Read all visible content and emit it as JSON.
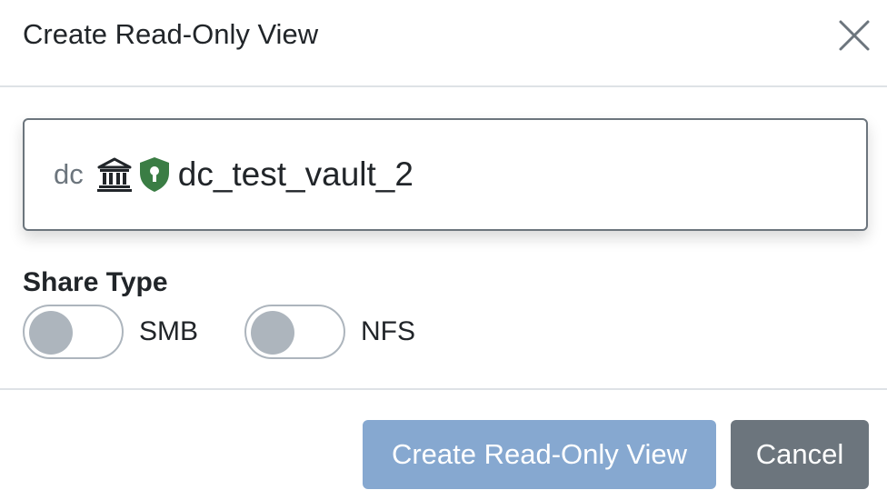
{
  "modal": {
    "title": "Create Read-Only View",
    "close_icon": "close-icon"
  },
  "source": {
    "cluster": "dc",
    "vault_icon": "vault-bank-icon",
    "shield_icon": "shield-lock-icon",
    "shield_color": "#3a7d44",
    "vault_name": "dc_test_vault_2"
  },
  "share_type": {
    "label": "Share Type",
    "options": [
      {
        "label": "SMB",
        "enabled": false
      },
      {
        "label": "NFS",
        "enabled": false
      }
    ]
  },
  "footer": {
    "create_label": "Create Read-Only View",
    "cancel_label": "Cancel",
    "primary_color": "#86a8d0",
    "secondary_color": "#6c757d"
  }
}
